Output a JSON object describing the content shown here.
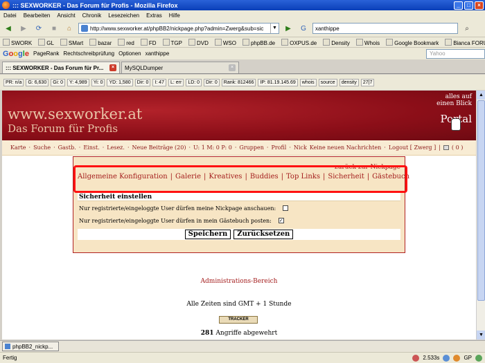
{
  "window": {
    "title": "::: SEXWORKER - Das Forum für Profis - Mozilla Firefox"
  },
  "menu": [
    "Datei",
    "Bearbeiten",
    "Ansicht",
    "Chronik",
    "Lesezeichen",
    "Extras",
    "Hilfe"
  ],
  "nav": {
    "url": "http://www.sexworker.at/phpBB2/nickpage.php?admin=Zwerg&sub=sic",
    "search_value": "xanthippe"
  },
  "bookmarks": [
    "SWORK",
    "GL",
    "SMart",
    "bazar",
    "red",
    "FD",
    "TGP",
    "DVD",
    "WSO",
    "phpBB.de",
    "OXPUS.de",
    "Density",
    "Whois",
    "Google Bookmark",
    "Bianca FORUM ..."
  ],
  "google_bar": {
    "logo": "Google",
    "pagerank": "PageRank",
    "spell": "Rechtschreibprüfung",
    "options": "Optionen",
    "query": "xanthippe",
    "yahoo_placeholder": "Yahoo"
  },
  "tabs": [
    {
      "label": "::: SEXWORKER - Das Forum für Pr..."
    },
    {
      "label": "MySQLDumper"
    }
  ],
  "seo_bar": [
    "PR: n/a",
    "G: 6,630",
    "Gi: 0",
    "Y: 4,989",
    "Yi: 0",
    "YD: 1,580",
    "Dir: 0",
    "I: 47",
    "L: err",
    "LD: 0",
    "Dir: 0",
    "Rank: 812466",
    "IP: 81.19.145.69",
    "whois",
    "source",
    "density",
    "27|7"
  ],
  "banner": {
    "site_name": "www.sexworker.at",
    "site_sub": "Das Forum für Profis",
    "portal_line1": "alles auf",
    "portal_line2": "einen Blick",
    "portal_title": "Portal"
  },
  "forum_nav": [
    "Karte",
    "Suche",
    "Gastb.",
    "Einst.",
    "Lesez.",
    "Neue Beiträge (20)",
    "U: 1 M: 0 P: 0",
    "Gruppen",
    "Profil",
    "Nick",
    "Keine neuen Nachrichten",
    "Logout [ Zwerg ]",
    "( 0 )"
  ],
  "panel": {
    "back_link": "zurück zur Nickpage",
    "tabs": [
      "Allgemeine Konfiguration",
      "Galerie",
      "Kreatives",
      "Buddies",
      "Top Links",
      "Sicherheit",
      "Gästebuch"
    ],
    "section_title": "Sicherheit einstellen",
    "rows": [
      {
        "label": "Nur registrierte/eingeloggte User dürfen meine Nickpage anschauen:",
        "checked": false
      },
      {
        "label": "Nur registrierte/eingeloggte User dürfen in mein Gästebuch posten:",
        "checked": true
      }
    ],
    "save_label": "Speichern",
    "reset_label": "Zurücksetzen"
  },
  "footer": {
    "admin_link": "Administrations-Bereich",
    "timezone": "Alle Zeiten sind GMT + 1 Stunde",
    "tracker_label": "TRACKER",
    "attacks_count": "281",
    "attacks_text": "Angriffe abgewehrt"
  },
  "taskbar": {
    "item": "phpBB2_nickp..."
  },
  "status": {
    "left": "Fertig",
    "time": "2.533s",
    "gp": "GP"
  },
  "colors": {
    "highlight": "#ff1111",
    "link": "#a31b1b",
    "banner": "#8b0e18"
  }
}
